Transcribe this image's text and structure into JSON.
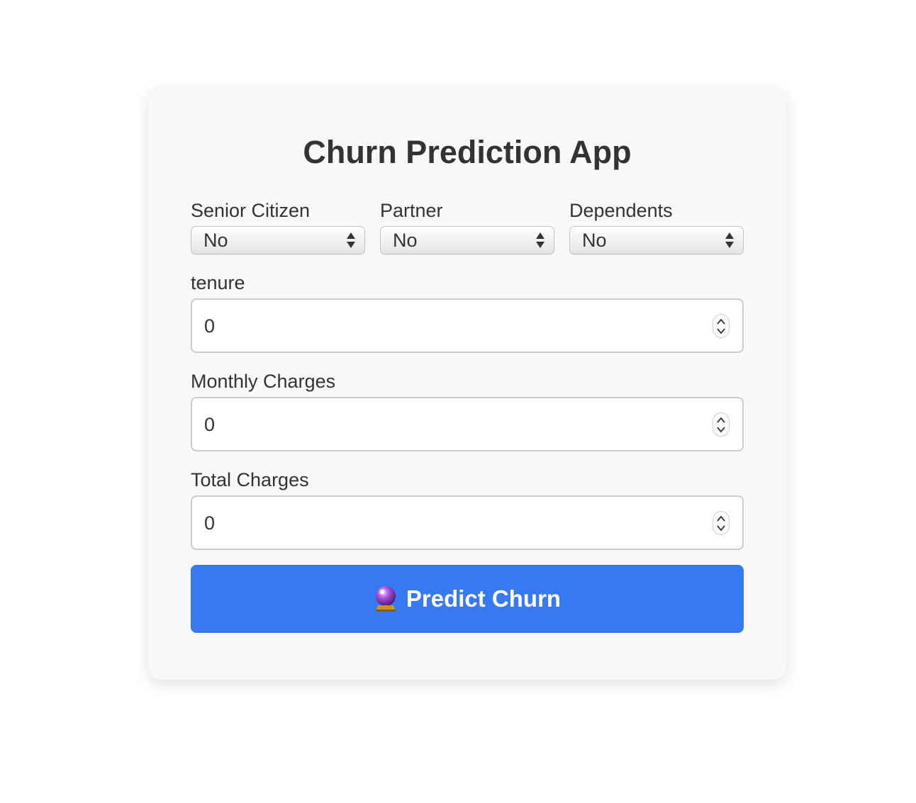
{
  "app": {
    "title": "Churn Prediction App"
  },
  "form": {
    "senior_citizen": {
      "label": "Senior Citizen",
      "value": "No"
    },
    "partner": {
      "label": "Partner",
      "value": "No"
    },
    "dependents": {
      "label": "Dependents",
      "value": "No"
    },
    "tenure": {
      "label": "tenure",
      "value": "0"
    },
    "monthly_charges": {
      "label": "Monthly Charges",
      "value": "0"
    },
    "total_charges": {
      "label": "Total Charges",
      "value": "0"
    },
    "submit_label": "Predict Churn",
    "submit_icon": "crystal-ball-icon"
  },
  "colors": {
    "accent": "#3779f1",
    "card_background": "#f8f8f8",
    "text": "#333333"
  }
}
